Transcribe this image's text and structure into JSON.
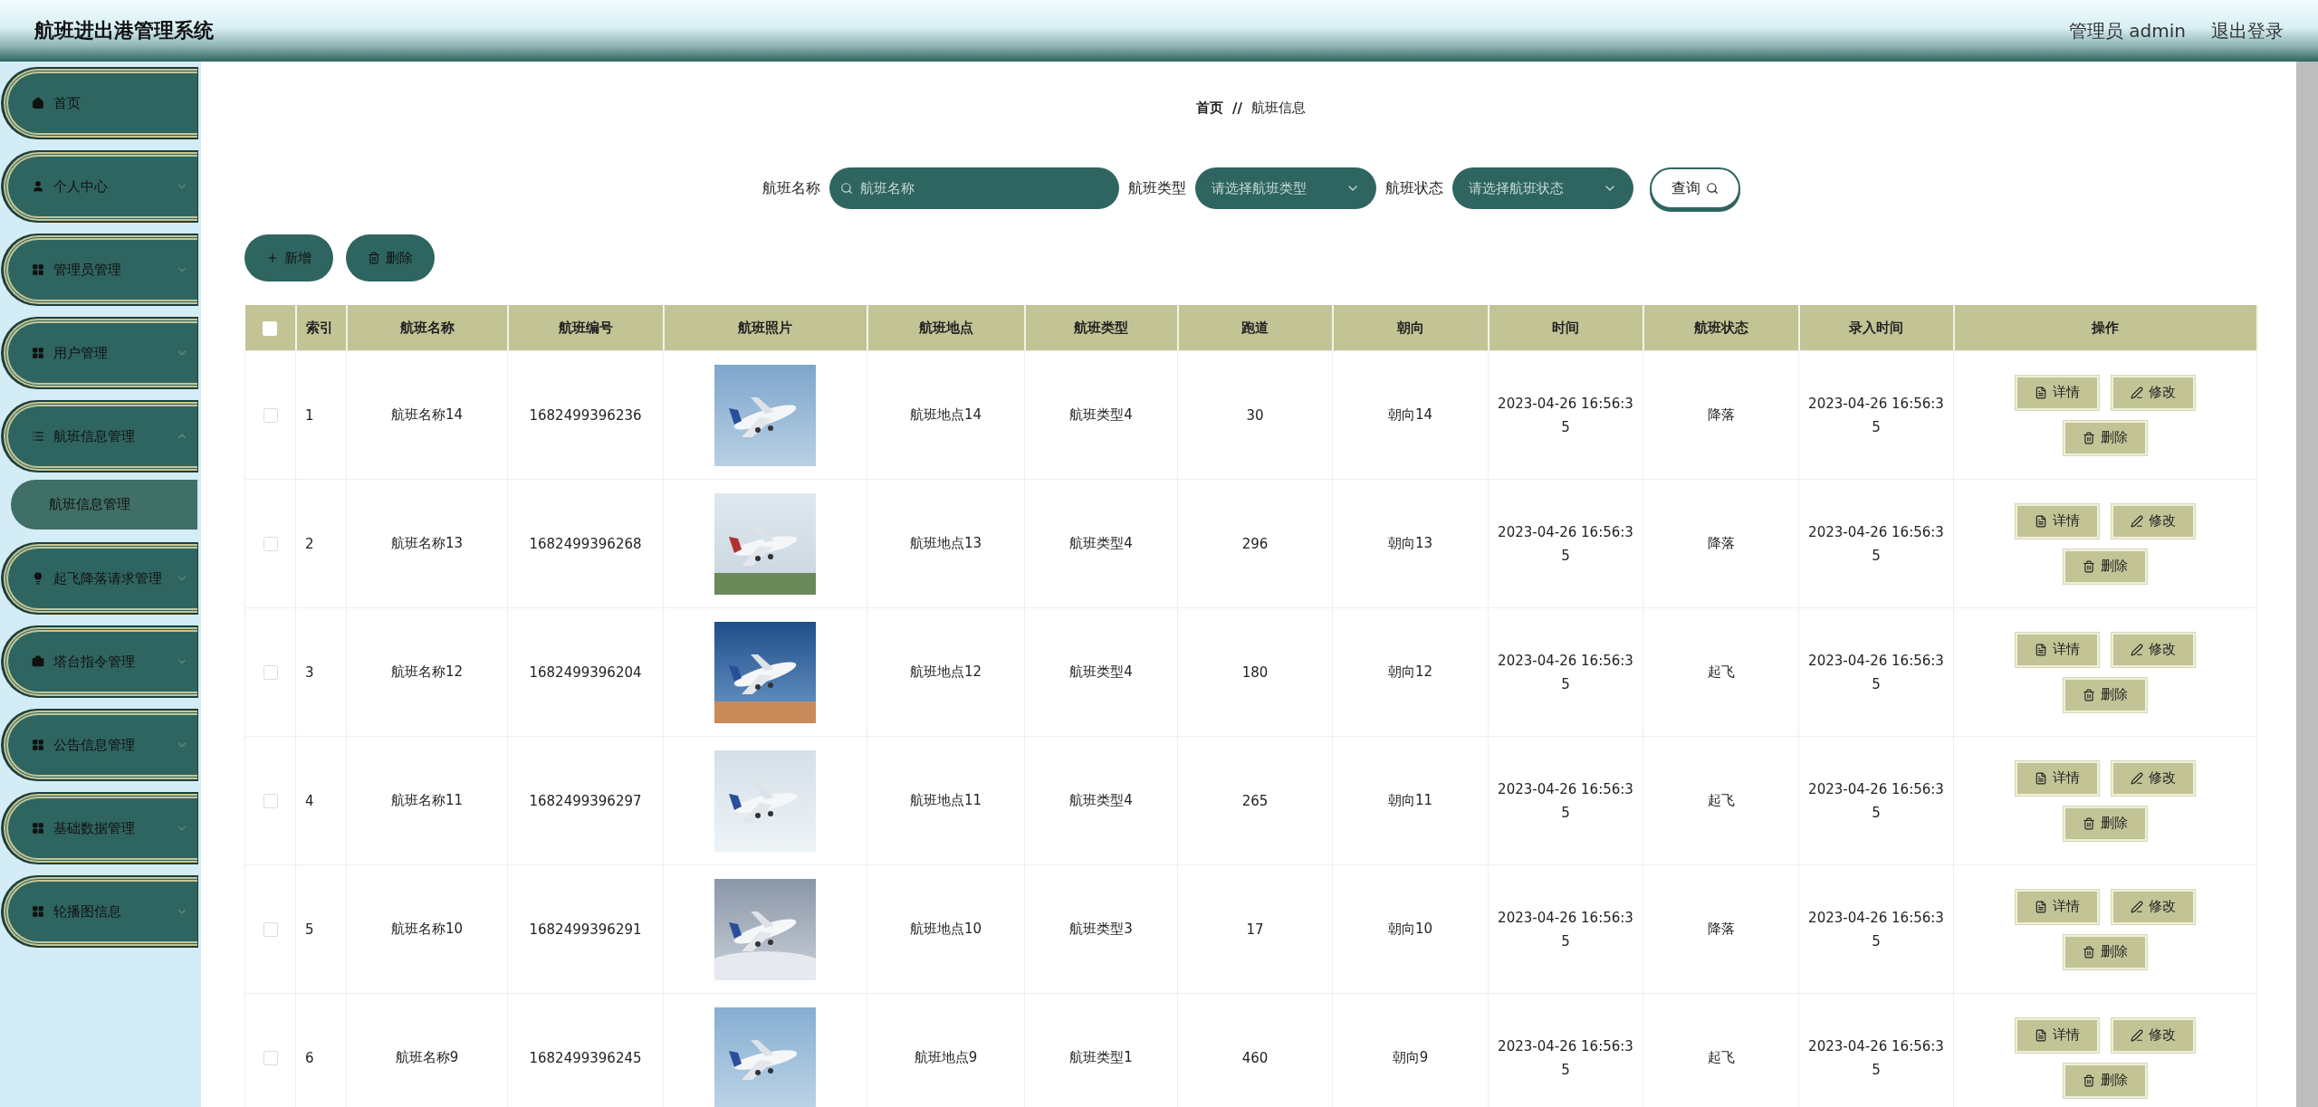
{
  "header": {
    "title": "航班进出港管理系统",
    "user": "管理员 admin",
    "logout": "退出登录"
  },
  "sidebar": {
    "items": [
      {
        "label": "首页",
        "has_arrow": false
      },
      {
        "label": "个人中心",
        "has_arrow": true,
        "expanded": false
      },
      {
        "label": "管理员管理",
        "has_arrow": true,
        "expanded": false
      },
      {
        "label": "用户管理",
        "has_arrow": true,
        "expanded": false
      },
      {
        "label": "航班信息管理",
        "has_arrow": true,
        "expanded": true,
        "children": [
          {
            "label": "航班信息管理",
            "selected": true
          }
        ]
      },
      {
        "label": "起飞降落请求管理",
        "has_arrow": true,
        "expanded": false
      },
      {
        "label": "塔台指令管理",
        "has_arrow": true,
        "expanded": false
      },
      {
        "label": "公告信息管理",
        "has_arrow": true,
        "expanded": false
      },
      {
        "label": "基础数据管理",
        "has_arrow": true,
        "expanded": false
      },
      {
        "label": "轮播图信息",
        "has_arrow": true,
        "expanded": false
      }
    ]
  },
  "breadcrumb": [
    "首页",
    "航班信息"
  ],
  "breadcrumb_separator": "//",
  "search": {
    "fields": [
      {
        "kind": "text",
        "label": "航班名称",
        "placeholder": "航班名称"
      },
      {
        "kind": "select",
        "label": "航班类型",
        "placeholder": "请选择航班类型"
      },
      {
        "kind": "select",
        "label": "航班状态",
        "placeholder": "请选择航班状态"
      }
    ],
    "button": "查询"
  },
  "toolbar": [
    {
      "kind": "add",
      "label": "新增"
    },
    {
      "kind": "delete",
      "label": "删除"
    }
  ],
  "table": {
    "select_all_checked": false,
    "columns": [
      "索引",
      "航班名称",
      "航班编号",
      "航班照片",
      "航班地点",
      "航班类型",
      "跑道",
      "朝向",
      "时间",
      "航班状态",
      "录入时间",
      "操作"
    ],
    "rows": [
      {
        "checked": false,
        "cells": [
          "1",
          "航班名称14",
          "1682499396236",
          {
            "kind": "picture"
          },
          "航班地点14",
          "航班类型4",
          "30",
          "朝向14",
          "2023-04-26 16:56:35",
          "降落",
          "2023-04-26 16:56:35"
        ],
        "actions": [
          "详情",
          "修改",
          "删除"
        ]
      },
      {
        "checked": false,
        "cells": [
          "2",
          "航班名称13",
          "1682499396268",
          {
            "kind": "picture"
          },
          "航班地点13",
          "航班类型4",
          "296",
          "朝向13",
          "2023-04-26 16:56:35",
          "降落",
          "2023-04-26 16:56:35"
        ],
        "actions": [
          "详情",
          "修改",
          "删除"
        ]
      },
      {
        "checked": false,
        "cells": [
          "3",
          "航班名称12",
          "1682499396204",
          {
            "kind": "picture"
          },
          "航班地点12",
          "航班类型4",
          "180",
          "朝向12",
          "2023-04-26 16:56:35",
          "起飞",
          "2023-04-26 16:56:35"
        ],
        "actions": [
          "详情",
          "修改",
          "删除"
        ]
      },
      {
        "checked": false,
        "cells": [
          "4",
          "航班名称11",
          "1682499396297",
          {
            "kind": "picture"
          },
          "航班地点11",
          "航班类型4",
          "265",
          "朝向11",
          "2023-04-26 16:56:35",
          "起飞",
          "2023-04-26 16:56:35"
        ],
        "actions": [
          "详情",
          "修改",
          "删除"
        ]
      },
      {
        "checked": false,
        "cells": [
          "5",
          "航班名称10",
          "1682499396291",
          {
            "kind": "picture"
          },
          "航班地点10",
          "航班类型3",
          "17",
          "朝向10",
          "2023-04-26 16:56:35",
          "降落",
          "2023-04-26 16:56:35"
        ],
        "actions": [
          "详情",
          "修改",
          "删除"
        ]
      },
      {
        "checked": false,
        "cells": [
          "6",
          "航班名称9",
          "1682499396245",
          {
            "kind": "picture"
          },
          "航班地点9",
          "航班类型1",
          "460",
          "朝向9",
          "2023-04-26 16:56:35",
          "起飞",
          "2023-04-26 16:56:35"
        ],
        "actions": [
          "详情",
          "修改",
          "删除"
        ]
      }
    ]
  }
}
